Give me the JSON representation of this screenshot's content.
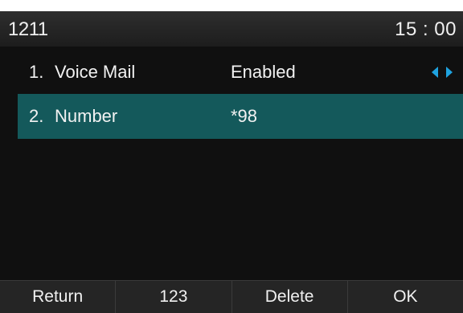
{
  "status": {
    "account": "1211",
    "time": "15 : 00"
  },
  "rows": [
    {
      "index": "1.",
      "label": "Voice Mail",
      "value": "Enabled",
      "selected": false
    },
    {
      "index": "2.",
      "label": "Number",
      "value": "*98",
      "selected": true
    }
  ],
  "softkeys": [
    "Return",
    "123",
    "Delete",
    "OK"
  ],
  "colors": {
    "background": "#101010",
    "highlight": "#14595b",
    "arrow": "#1fa3e0"
  },
  "icons": [
    "arrow-left-icon",
    "arrow-right-icon"
  ]
}
